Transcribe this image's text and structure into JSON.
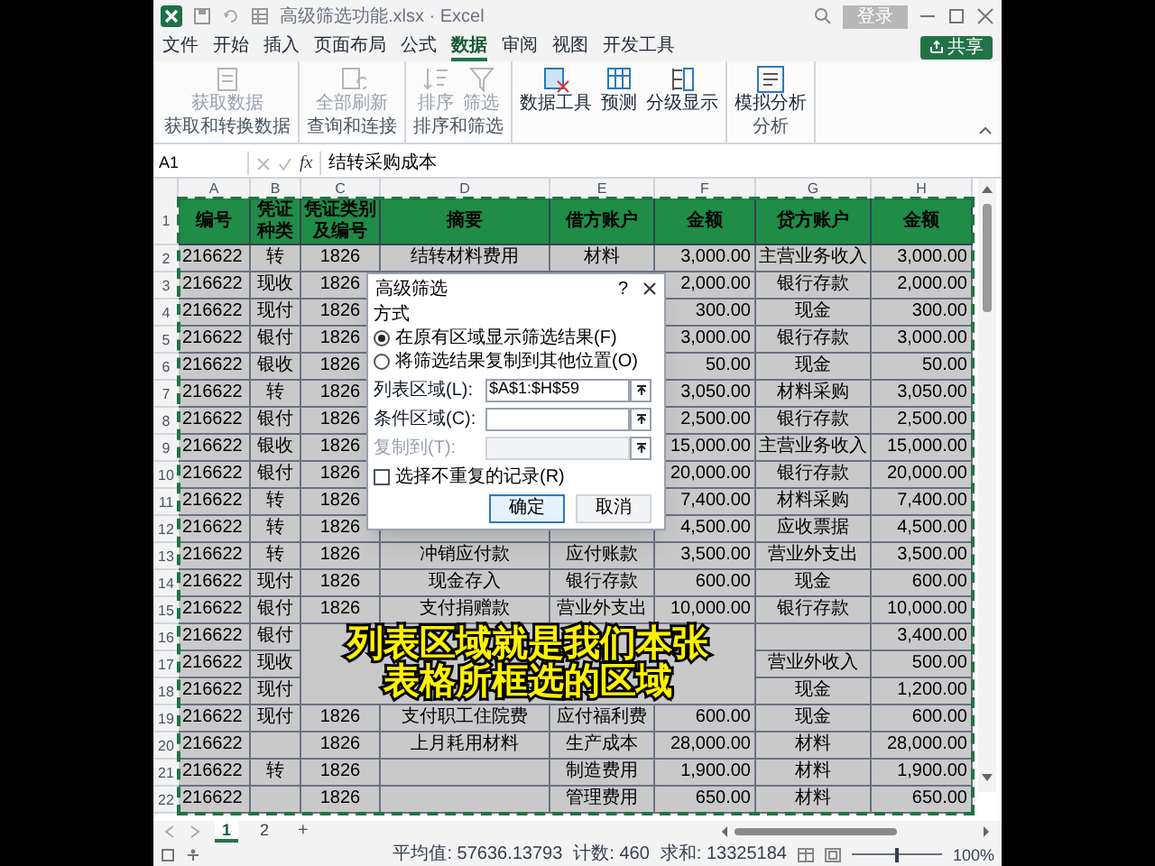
{
  "window": {
    "title": "高级筛选功能.xlsx · Excel",
    "login_button": "登录"
  },
  "menu_tabs": [
    {
      "label": "文件",
      "selected": false
    },
    {
      "label": "开始",
      "selected": false
    },
    {
      "label": "插入",
      "selected": false
    },
    {
      "label": "页面布局",
      "selected": false
    },
    {
      "label": "公式",
      "selected": false
    },
    {
      "label": "数据",
      "selected": true
    },
    {
      "label": "审阅",
      "selected": false
    },
    {
      "label": "视图",
      "selected": false
    },
    {
      "label": "开发工具",
      "selected": false
    }
  ],
  "share_button": "共享",
  "ribbon": {
    "groups": [
      {
        "label": "获取和转换数据",
        "items": [
          {
            "label": "获取数据",
            "disabled": true
          }
        ]
      },
      {
        "label": "查询和连接",
        "items": [
          {
            "label": "全部刷新",
            "disabled": true
          }
        ]
      },
      {
        "label": "排序和筛选",
        "items": [
          {
            "label": "排序",
            "disabled": true
          },
          {
            "label": "筛选",
            "disabled": true
          }
        ]
      },
      {
        "items": [
          {
            "label": "数据工具",
            "disabled": false
          },
          {
            "label": "预测",
            "disabled": false
          },
          {
            "label": "分级显示",
            "disabled": false
          }
        ]
      },
      {
        "label": "分析",
        "items": [
          {
            "label": "模拟分析",
            "disabled": false
          }
        ]
      }
    ]
  },
  "formula_bar": {
    "name_box": "A1",
    "fx": "fx",
    "value": "结转采购成本"
  },
  "columns": [
    "A",
    "B",
    "C",
    "D",
    "E",
    "F",
    "G",
    "H"
  ],
  "table": {
    "header_row": "1",
    "header": [
      "编号",
      "凭证种类",
      "凭证类别及编号",
      "摘要",
      "借方账户",
      "金额",
      "贷方账户",
      "金额"
    ],
    "rows": [
      {
        "row": "2",
        "cells": [
          "216622",
          "转",
          "1826",
          "结转材料费用",
          "材料",
          "3,000.00",
          "主营业务收入",
          "3,000.00"
        ]
      },
      {
        "row": "3",
        "cells": [
          "216622",
          "现收",
          "1826",
          null,
          null,
          "2,000.00",
          "银行存款",
          "2,000.00"
        ]
      },
      {
        "row": "4",
        "cells": [
          "216622",
          "现付",
          "1826",
          null,
          null,
          "300.00",
          "现金",
          "300.00"
        ]
      },
      {
        "row": "5",
        "cells": [
          "216622",
          "银付",
          "1826",
          null,
          null,
          "3,000.00",
          "银行存款",
          "3,000.00"
        ]
      },
      {
        "row": "6",
        "cells": [
          "216622",
          "银收",
          "1826",
          null,
          null,
          "50.00",
          "现金",
          "50.00"
        ]
      },
      {
        "row": "7",
        "cells": [
          "216622",
          "转",
          "1826",
          null,
          null,
          "3,050.00",
          "材料采购",
          "3,050.00"
        ]
      },
      {
        "row": "8",
        "cells": [
          "216622",
          "银付",
          "1826",
          null,
          null,
          "2,500.00",
          "银行存款",
          "2,500.00"
        ]
      },
      {
        "row": "9",
        "cells": [
          "216622",
          "银收",
          "1826",
          null,
          null,
          "15,000.00",
          "主营业务收入",
          "15,000.00"
        ]
      },
      {
        "row": "10",
        "cells": [
          "216622",
          "银付",
          "1826",
          null,
          null,
          "20,000.00",
          "银行存款",
          "20,000.00"
        ]
      },
      {
        "row": "11",
        "cells": [
          "216622",
          "转",
          "1826",
          null,
          null,
          "7,400.00",
          "材料采购",
          "7,400.00"
        ]
      },
      {
        "row": "12",
        "cells": [
          "216622",
          "转",
          "1826",
          null,
          null,
          "4,500.00",
          "应收票据",
          "4,500.00"
        ]
      },
      {
        "row": "13",
        "cells": [
          "216622",
          "转",
          "1826",
          "冲销应付款",
          "应付账款",
          "3,500.00",
          "营业外支出",
          "3,500.00"
        ]
      },
      {
        "row": "14",
        "cells": [
          "216622",
          "现付",
          "1826",
          "现金存入",
          "银行存款",
          "600.00",
          "现金",
          "600.00"
        ]
      },
      {
        "row": "15",
        "cells": [
          "216622",
          "银付",
          "1826",
          "支付捐赠款",
          "营业外支出",
          "10,000.00",
          "银行存款",
          "10,000.00"
        ]
      },
      {
        "row": "16",
        "covered_by_caption": true,
        "cells": [
          "216622",
          "银付",
          null,
          null,
          null,
          null,
          null,
          "3,400.00"
        ]
      },
      {
        "row": "17",
        "covered_by_caption": true,
        "cells": [
          "216622",
          "现收",
          null,
          null,
          null,
          null,
          "营业外收入",
          "500.00"
        ]
      },
      {
        "row": "18",
        "covered_by_caption": true,
        "cells": [
          "216622",
          "现付",
          null,
          null,
          null,
          null,
          "现金",
          "1,200.00"
        ]
      },
      {
        "row": "19",
        "cells": [
          "216622",
          "现付",
          "1826",
          "支付职工住院费",
          "应付福利费",
          "600.00",
          "现金",
          "600.00"
        ]
      },
      {
        "row": "20",
        "cells": [
          "216622",
          null,
          "1826",
          "上月耗用材料",
          "生产成本",
          "28,000.00",
          "材料",
          "28,000.00"
        ]
      },
      {
        "row": "21",
        "cells": [
          "216622",
          "转",
          "1826",
          null,
          "制造费用",
          "1,900.00",
          "材料",
          "1,900.00"
        ]
      },
      {
        "row": "22",
        "cells": [
          "216622",
          null,
          "1826",
          null,
          "管理费用",
          "650.00",
          "材料",
          "650.00"
        ]
      }
    ]
  },
  "dialog": {
    "title": "高级筛选",
    "help": "?",
    "section": "方式",
    "options": [
      {
        "label": "在原有区域显示筛选结果(F)",
        "selected": true
      },
      {
        "label": "将筛选结果复制到其他位置(O)",
        "selected": false
      }
    ],
    "fields": [
      {
        "label": "列表区域(L):",
        "value": "$A$1:$H$59",
        "disabled": false
      },
      {
        "label": "条件区域(C):",
        "disabled": false
      },
      {
        "label": "复制到(T):",
        "disabled": true
      }
    ],
    "unique_checkbox": {
      "label": "选择不重复的记录(R)",
      "checked": false
    },
    "buttons": [
      "确定",
      "取消"
    ]
  },
  "caption": [
    "列表区域就是我们本张",
    "表格所框选的区域"
  ],
  "sheet_tabs": [
    {
      "label": "1",
      "selected": true
    },
    {
      "label": "2",
      "selected": false
    }
  ],
  "add_sheet": "+",
  "status_bar": {
    "average": "平均值: 57636.13793",
    "count": "计数: 460",
    "sum": "求和: 13325184",
    "zoom": "100%",
    "zoom_slider": {
      "level": 0.5
    }
  }
}
